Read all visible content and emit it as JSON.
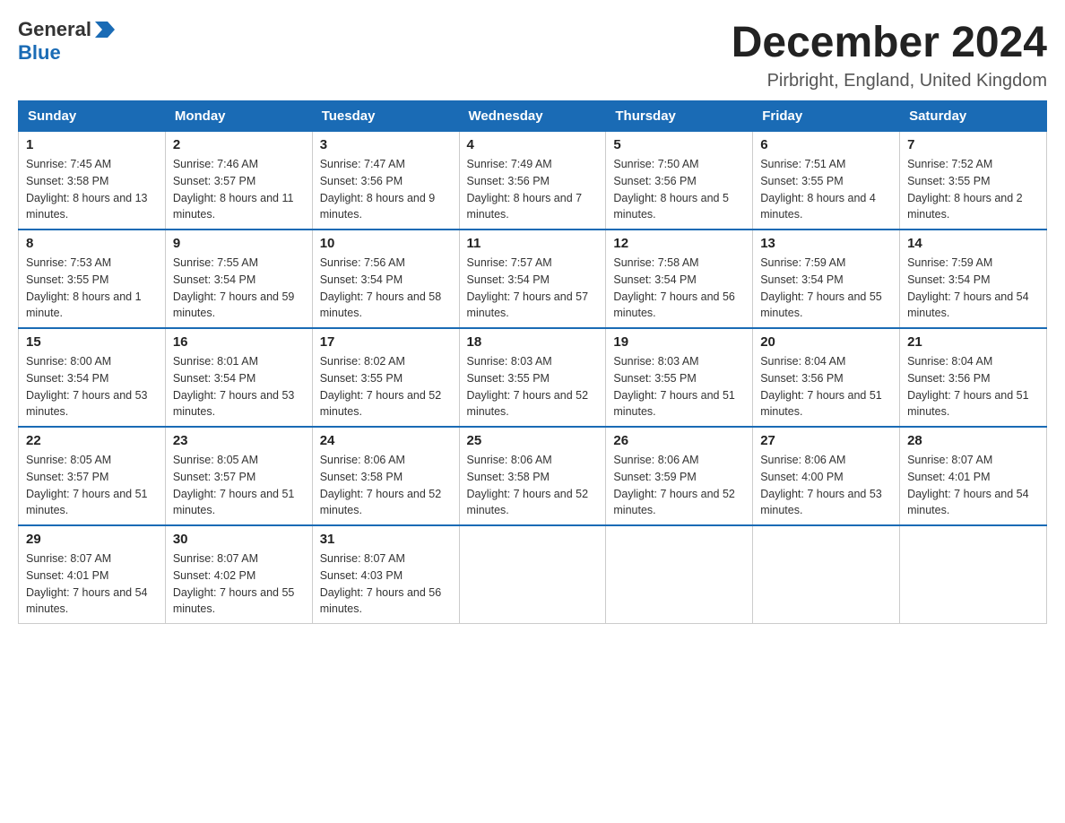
{
  "logo": {
    "general": "General",
    "blue": "Blue"
  },
  "title": "December 2024",
  "location": "Pirbright, England, United Kingdom",
  "days_of_week": [
    "Sunday",
    "Monday",
    "Tuesday",
    "Wednesday",
    "Thursday",
    "Friday",
    "Saturday"
  ],
  "weeks": [
    [
      {
        "day": "1",
        "sunrise": "7:45 AM",
        "sunset": "3:58 PM",
        "daylight": "8 hours and 13 minutes."
      },
      {
        "day": "2",
        "sunrise": "7:46 AM",
        "sunset": "3:57 PM",
        "daylight": "8 hours and 11 minutes."
      },
      {
        "day": "3",
        "sunrise": "7:47 AM",
        "sunset": "3:56 PM",
        "daylight": "8 hours and 9 minutes."
      },
      {
        "day": "4",
        "sunrise": "7:49 AM",
        "sunset": "3:56 PM",
        "daylight": "8 hours and 7 minutes."
      },
      {
        "day": "5",
        "sunrise": "7:50 AM",
        "sunset": "3:56 PM",
        "daylight": "8 hours and 5 minutes."
      },
      {
        "day": "6",
        "sunrise": "7:51 AM",
        "sunset": "3:55 PM",
        "daylight": "8 hours and 4 minutes."
      },
      {
        "day": "7",
        "sunrise": "7:52 AM",
        "sunset": "3:55 PM",
        "daylight": "8 hours and 2 minutes."
      }
    ],
    [
      {
        "day": "8",
        "sunrise": "7:53 AM",
        "sunset": "3:55 PM",
        "daylight": "8 hours and 1 minute."
      },
      {
        "day": "9",
        "sunrise": "7:55 AM",
        "sunset": "3:54 PM",
        "daylight": "7 hours and 59 minutes."
      },
      {
        "day": "10",
        "sunrise": "7:56 AM",
        "sunset": "3:54 PM",
        "daylight": "7 hours and 58 minutes."
      },
      {
        "day": "11",
        "sunrise": "7:57 AM",
        "sunset": "3:54 PM",
        "daylight": "7 hours and 57 minutes."
      },
      {
        "day": "12",
        "sunrise": "7:58 AM",
        "sunset": "3:54 PM",
        "daylight": "7 hours and 56 minutes."
      },
      {
        "day": "13",
        "sunrise": "7:59 AM",
        "sunset": "3:54 PM",
        "daylight": "7 hours and 55 minutes."
      },
      {
        "day": "14",
        "sunrise": "7:59 AM",
        "sunset": "3:54 PM",
        "daylight": "7 hours and 54 minutes."
      }
    ],
    [
      {
        "day": "15",
        "sunrise": "8:00 AM",
        "sunset": "3:54 PM",
        "daylight": "7 hours and 53 minutes."
      },
      {
        "day": "16",
        "sunrise": "8:01 AM",
        "sunset": "3:54 PM",
        "daylight": "7 hours and 53 minutes."
      },
      {
        "day": "17",
        "sunrise": "8:02 AM",
        "sunset": "3:55 PM",
        "daylight": "7 hours and 52 minutes."
      },
      {
        "day": "18",
        "sunrise": "8:03 AM",
        "sunset": "3:55 PM",
        "daylight": "7 hours and 52 minutes."
      },
      {
        "day": "19",
        "sunrise": "8:03 AM",
        "sunset": "3:55 PM",
        "daylight": "7 hours and 51 minutes."
      },
      {
        "day": "20",
        "sunrise": "8:04 AM",
        "sunset": "3:56 PM",
        "daylight": "7 hours and 51 minutes."
      },
      {
        "day": "21",
        "sunrise": "8:04 AM",
        "sunset": "3:56 PM",
        "daylight": "7 hours and 51 minutes."
      }
    ],
    [
      {
        "day": "22",
        "sunrise": "8:05 AM",
        "sunset": "3:57 PM",
        "daylight": "7 hours and 51 minutes."
      },
      {
        "day": "23",
        "sunrise": "8:05 AM",
        "sunset": "3:57 PM",
        "daylight": "7 hours and 51 minutes."
      },
      {
        "day": "24",
        "sunrise": "8:06 AM",
        "sunset": "3:58 PM",
        "daylight": "7 hours and 52 minutes."
      },
      {
        "day": "25",
        "sunrise": "8:06 AM",
        "sunset": "3:58 PM",
        "daylight": "7 hours and 52 minutes."
      },
      {
        "day": "26",
        "sunrise": "8:06 AM",
        "sunset": "3:59 PM",
        "daylight": "7 hours and 52 minutes."
      },
      {
        "day": "27",
        "sunrise": "8:06 AM",
        "sunset": "4:00 PM",
        "daylight": "7 hours and 53 minutes."
      },
      {
        "day": "28",
        "sunrise": "8:07 AM",
        "sunset": "4:01 PM",
        "daylight": "7 hours and 54 minutes."
      }
    ],
    [
      {
        "day": "29",
        "sunrise": "8:07 AM",
        "sunset": "4:01 PM",
        "daylight": "7 hours and 54 minutes."
      },
      {
        "day": "30",
        "sunrise": "8:07 AM",
        "sunset": "4:02 PM",
        "daylight": "7 hours and 55 minutes."
      },
      {
        "day": "31",
        "sunrise": "8:07 AM",
        "sunset": "4:03 PM",
        "daylight": "7 hours and 56 minutes."
      },
      null,
      null,
      null,
      null
    ]
  ]
}
